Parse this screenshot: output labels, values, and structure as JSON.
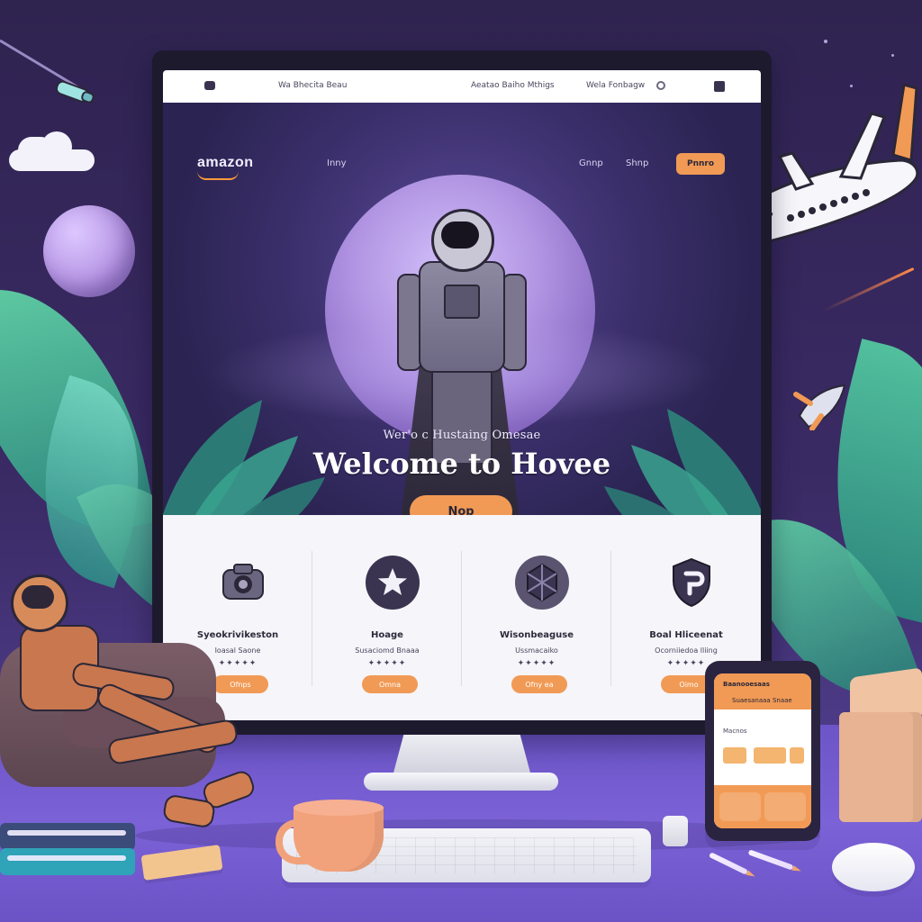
{
  "browser_bar": {
    "links": [
      "Wa Bhecita Beau",
      "Aeatao Baiho Mthigs",
      "Wela Fonbagw"
    ]
  },
  "site": {
    "logo": "amazon",
    "nav": [
      "Inny",
      "Gnnp",
      "Shnp"
    ],
    "header_button": "Pnnro"
  },
  "hero": {
    "kicker": "Wer'o c Hustaing Omesae",
    "title": "Welcome to Hovee",
    "cta": "Nop"
  },
  "features": [
    {
      "title": "Syeokrivikeston",
      "subtitle": "Ioasal Saone",
      "stars": "✦✦✦✦✦",
      "button": "Ofnps",
      "icon": "camera-icon"
    },
    {
      "title": "Hoage",
      "subtitle": "Susaciomd Bnaaa",
      "stars": "✦✦✦✦✦",
      "button": "Omna",
      "icon": "star-icon"
    },
    {
      "title": "Wisonbeaguse",
      "subtitle": "Ussmacaiko",
      "stars": "✦✦✦✦✦",
      "button": "Ofny ea",
      "icon": "gem-icon"
    },
    {
      "title": "Boal Hliceenat",
      "subtitle": "Ocorniiedoa lliing",
      "stars": "✦✦✦✦✦",
      "button": "Oimo",
      "icon": "shield-icon"
    }
  ],
  "phone": {
    "top_title": "Baanooesaas",
    "top_subtitle": "Suaesanaaa Snaae",
    "section_label": "Macnos"
  },
  "colors": {
    "accent": "#F19A55",
    "background_purple": "#3B2B66",
    "panel_white": "#F6F5FA"
  }
}
